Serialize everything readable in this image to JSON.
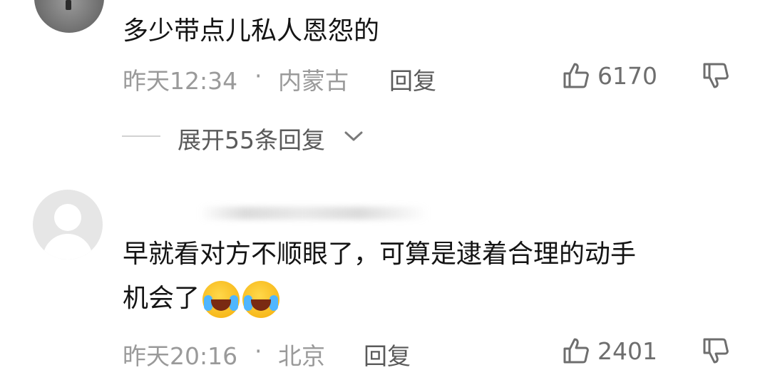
{
  "comments": [
    {
      "text_line1": "多少带点儿私人恩怨的",
      "time": "昨天12:34",
      "separator": "·",
      "location": "内蒙古",
      "reply_label": "回复",
      "likes": "6170",
      "expand_text": "展开55条回复"
    },
    {
      "text_line1": "早就看对方不顺眼了，可算是逮着合理的动手",
      "text_line2": "机会了",
      "emoji_names": [
        "rofl-emoji",
        "rofl-emoji"
      ],
      "time": "昨天20:16",
      "separator": "·",
      "location": "北京",
      "reply_label": "回复",
      "likes": "2401"
    }
  ],
  "icons": {
    "like": "thumbs-up-icon",
    "dislike": "thumbs-down-icon",
    "expand": "chevron-down-icon"
  },
  "colors": {
    "text": "#141414",
    "meta": "#9a9a9a",
    "secondary": "#5a5a5a"
  }
}
